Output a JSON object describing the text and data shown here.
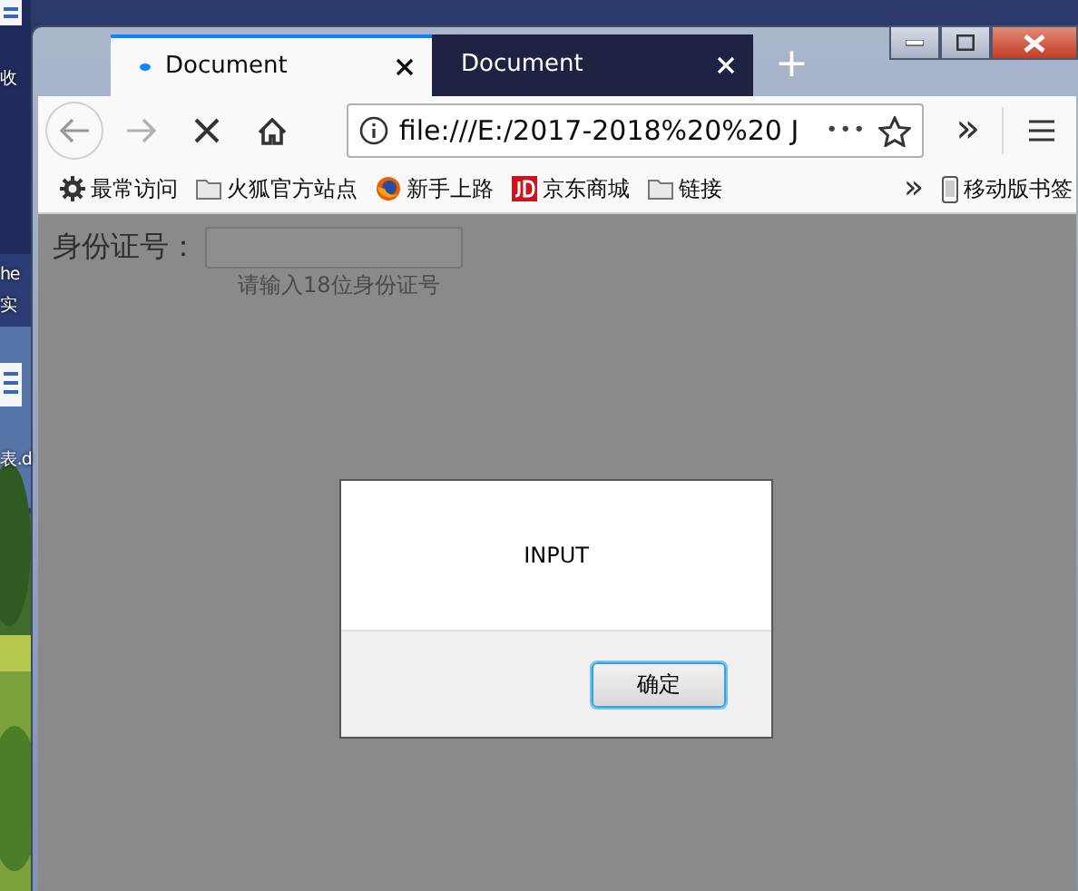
{
  "desktop_icons": [
    {
      "label": "收"
    },
    {
      "label": "he"
    },
    {
      "label": "实"
    },
    {
      "label": "表.d"
    }
  ],
  "tabs": [
    {
      "title": "Document",
      "selected": true
    },
    {
      "title": "Document",
      "selected": false
    }
  ],
  "new_tab": "+",
  "navigation": {
    "back_disabled": false,
    "forward_disabled": true,
    "loading": true
  },
  "address_bar": {
    "url": "file:///E:/2017-2018%20%20 J",
    "more": "•••"
  },
  "toolbar_overflow": "»",
  "bookmarks": [
    {
      "kind": "gear",
      "label": "最常访问"
    },
    {
      "kind": "folder",
      "label": "火狐官方站点"
    },
    {
      "kind": "firefox",
      "label": "新手上路"
    },
    {
      "kind": "jd",
      "label": "京东商城"
    },
    {
      "kind": "folder",
      "label": "链接"
    }
  ],
  "bookmarks_overflow": "»",
  "mobile_bookmarks": "移动版书签",
  "page": {
    "label": "身份证号：",
    "hint": "请输入18位身份证号"
  },
  "dialog": {
    "message": "INPUT",
    "button": {
      "label": "确定",
      "focused": true
    }
  }
}
